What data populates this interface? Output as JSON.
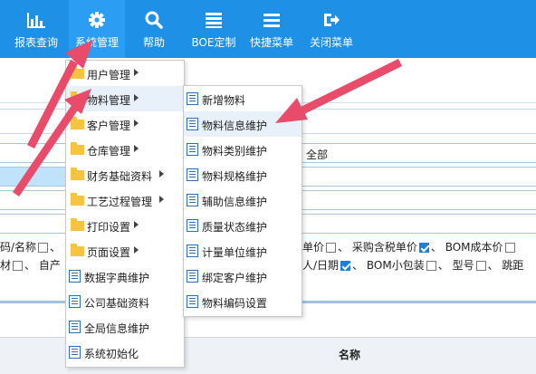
{
  "colors": {
    "toolbar": "#1e90e6",
    "accent": "#e94b6a",
    "folder": "#f5c542"
  },
  "toolbar": {
    "items": [
      {
        "label": "报表查询",
        "icon": "bar-chart-icon"
      },
      {
        "label": "系统管理",
        "icon": "gear-icon"
      },
      {
        "label": "帮助",
        "icon": "search-icon"
      },
      {
        "label": "BOE定制",
        "icon": "list-icon"
      },
      {
        "label": "快捷菜单",
        "icon": "menu-icon"
      },
      {
        "label": "关闭菜单",
        "icon": "exit-icon"
      }
    ]
  },
  "system_menu": {
    "items": [
      {
        "label": "用户管理",
        "icon": "folder-icon",
        "has_sub": true
      },
      {
        "label": "物料管理",
        "icon": "folder-icon",
        "has_sub": true
      },
      {
        "label": "客户管理",
        "icon": "folder-icon",
        "has_sub": true
      },
      {
        "label": "仓库管理",
        "icon": "folder-icon",
        "has_sub": true
      },
      {
        "label": "财务基础资料",
        "icon": "folder-icon",
        "has_sub": true
      },
      {
        "label": "工艺过程管理",
        "icon": "folder-icon",
        "has_sub": true
      },
      {
        "label": "打印设置",
        "icon": "folder-icon",
        "has_sub": true
      },
      {
        "label": "页面设置",
        "icon": "folder-icon",
        "has_sub": true
      },
      {
        "label": "数据字典维护",
        "icon": "document-icon",
        "has_sub": false
      },
      {
        "label": "公司基础资料",
        "icon": "document-icon",
        "has_sub": false
      },
      {
        "label": "全局信息维护",
        "icon": "document-icon",
        "has_sub": false
      },
      {
        "label": "系统初始化",
        "icon": "document-icon",
        "has_sub": false
      }
    ]
  },
  "material_submenu": {
    "items": [
      {
        "label": "新增物料"
      },
      {
        "label": "物料信息维护"
      },
      {
        "label": "物料类别维护"
      },
      {
        "label": "物料规格维护"
      },
      {
        "label": "辅助信息维护"
      },
      {
        "label": "质量状态维护"
      },
      {
        "label": "计量单位维护"
      },
      {
        "label": "绑定客户维护"
      },
      {
        "label": "物料编码设置"
      }
    ]
  },
  "background": {
    "quanbu": "全部",
    "row1_left": "码/名称",
    "row1_price": "单价",
    "row1_purchase_tax": "采购含税单价",
    "row1_bom_cost": "BOM成本价",
    "row2_left": "材",
    "row2_origin": "自产",
    "row2_person_date": "人/日期",
    "row2_bom_pack": "BOM小包装",
    "row2_model": "型号",
    "row2_jump": "跳距",
    "sep": "、",
    "table_header_name": "名称"
  }
}
